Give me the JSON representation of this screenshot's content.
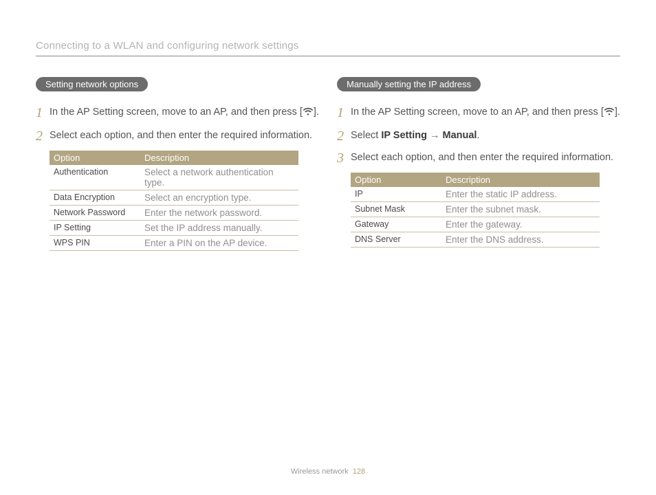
{
  "header": {
    "title": "Connecting to a WLAN and configuring network settings"
  },
  "left": {
    "pill": "Setting network options",
    "steps": {
      "s1_pre": "In the AP Setting screen, move to an AP, and then press [",
      "s1_post": "].",
      "s2": "Select each option, and then enter the required information."
    },
    "table": {
      "h1": "Option",
      "h2": "Description",
      "rows": [
        {
          "o": "Authentication",
          "d": "Select a network authentication type."
        },
        {
          "o": "Data Encryption",
          "d": "Select an encryption type."
        },
        {
          "o": "Network Password",
          "d": "Enter the network password."
        },
        {
          "o": "IP Setting",
          "d": "Set the IP address manually."
        },
        {
          "o": "WPS PIN",
          "d": "Enter a PIN on the AP device."
        }
      ]
    }
  },
  "right": {
    "pill": "Manually setting the IP address",
    "steps": {
      "s1_pre": "In the AP Setting screen, move to an AP, and then press [",
      "s1_post": "].",
      "s2_a": "Select ",
      "s2_b": "IP Setting",
      "s2_arrow": " → ",
      "s2_c": "Manual",
      "s2_d": ".",
      "s3": "Select each option, and then enter the required information."
    },
    "table": {
      "h1": "Option",
      "h2": "Description",
      "rows": [
        {
          "o": "IP",
          "d": "Enter the static IP address."
        },
        {
          "o": "Subnet Mask",
          "d": "Enter the subnet mask."
        },
        {
          "o": "Gateway",
          "d": "Enter the gateway."
        },
        {
          "o": "DNS Server",
          "d": "Enter the DNS address."
        }
      ]
    }
  },
  "footer": {
    "section": "Wireless network",
    "page": "128"
  },
  "nums": {
    "n1": "1",
    "n2": "2",
    "n3": "3"
  }
}
